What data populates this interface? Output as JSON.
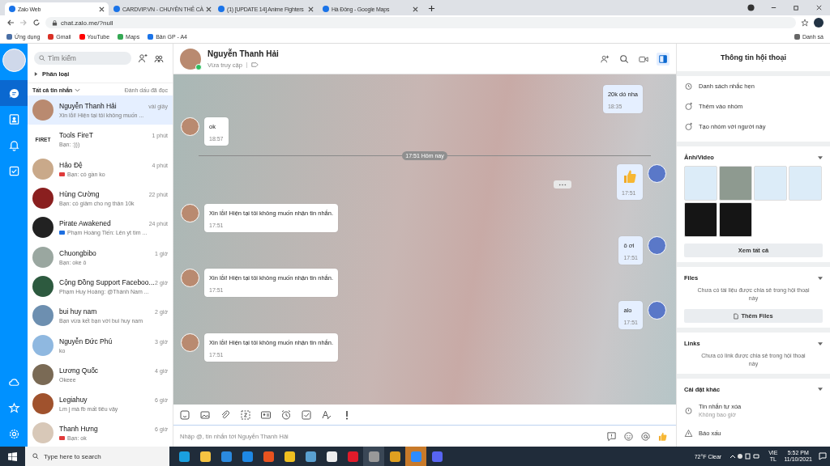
{
  "browser": {
    "tabs": [
      {
        "label": "Zalo Web",
        "selected": true
      },
      {
        "label": "CARDVIP.VN - CHUYÊN THẺ CÀ",
        "selected": false
      },
      {
        "label": "(1) [UPDATE 14] Anime Fighters",
        "selected": false
      },
      {
        "label": "Hà Đông - Google Maps",
        "selected": false
      }
    ],
    "address": "chat.zalo.me/?null",
    "bookmarks": [
      {
        "label": "Ứng dụng",
        "kind": "apps"
      },
      {
        "label": "Gmail",
        "kind": "gmail"
      },
      {
        "label": "YouTube",
        "kind": "youtube"
      },
      {
        "label": "Maps",
        "kind": "maps"
      },
      {
        "label": "Bản GP - A4",
        "kind": "site"
      }
    ],
    "reading_list": "Danh sá"
  },
  "conversation_list": {
    "search_placeholder": "Tìm kiếm",
    "category": "Phân loại",
    "filter": "Tất cả tin nhắn",
    "mark_read": "Đánh dấu đã đọc",
    "items": [
      {
        "name": "Nguyễn Thanh Hải",
        "time": "vài giây",
        "preview": "Xin lỗi! Hiện tại tôi không muốn ...",
        "selected": true
      },
      {
        "name": "Tools FireT",
        "time": "1 phút",
        "preview": "Bạn: :)))",
        "logo_text": "FIRET",
        "selected": false
      },
      {
        "name": "Hảo Đệ",
        "time": "4 phút",
        "preview": "Bạn: có gần ko",
        "color": "#e03b3b",
        "selected": false
      },
      {
        "name": "Hùng Cường",
        "time": "22 phút",
        "preview": "Bạn: có giảm cho ng thân 10k",
        "selected": false
      },
      {
        "name": "Pirate Awakened",
        "time": "24 phút",
        "preview": "Phạm Hoàng Tiến: Lên yt tìm ...",
        "color": "#1e6fe0",
        "selected": false
      },
      {
        "name": "Chuongbibo",
        "time": "1 giờ",
        "preview": "Bạn: oke ô",
        "selected": false
      },
      {
        "name": "Cộng Đồng Support Faceboo...",
        "time": "2 giờ",
        "preview": "Phạm Huy Hoàng: @Thành Nam ...",
        "selected": false
      },
      {
        "name": "bui huy nam",
        "time": "2 giờ",
        "preview": "Bạn vừa kết bạn với bui huy nam",
        "selected": false
      },
      {
        "name": "Nguyễn Đức Phú",
        "time": "3 giờ",
        "preview": "ko",
        "selected": false
      },
      {
        "name": "Lương Quốc",
        "time": "4 giờ",
        "preview": "Okeee",
        "selected": false
      },
      {
        "name": "Legiahuy",
        "time": "6 giờ",
        "preview": "Lm j mà fb mất tiêu vậy",
        "selected": false
      },
      {
        "name": "Thanh Hưng",
        "time": "6 giờ",
        "preview": "Bạn: ok",
        "color": "#e03b3b",
        "selected": false
      }
    ]
  },
  "chat": {
    "name": "Nguyễn Thanh Hải",
    "status": "Vừa truy cập",
    "messages": [
      {
        "kind": "outgoing",
        "text": "20k dó nha",
        "time": "18:35"
      },
      {
        "kind": "incoming",
        "text": "ok",
        "time": "18:57"
      },
      {
        "kind": "divider",
        "text": "17:51 Hôm nay"
      },
      {
        "kind": "like",
        "time": "17:51"
      },
      {
        "kind": "incoming",
        "text": "Xin lỗi! Hiện tại tôi không muốn nhận tin nhắn.",
        "time": "17:51"
      },
      {
        "kind": "outgoing",
        "text": "ô ơi",
        "time": "17:51"
      },
      {
        "kind": "incoming",
        "text": "Xin lỗi! Hiện tại tôi không muốn nhận tin nhắn.",
        "time": "17:51"
      },
      {
        "kind": "outgoing",
        "text": "alo",
        "time": "17:51"
      },
      {
        "kind": "incoming",
        "text": "Xin lỗi! Hiện tại tôi không muốn nhận tin nhắn.",
        "time": "17:51"
      }
    ],
    "input_placeholder": "Nhập @, tin nhắn tới Nguyễn Thanh Hải"
  },
  "info_panel": {
    "title": "Thông tin hội thoại",
    "actions": [
      "Danh sách nhắc hẹn",
      "Thêm vào nhóm",
      "Tạo nhóm với người này"
    ],
    "media": {
      "title": "Ảnh/Video",
      "thumbnails": [
        {
          "kind": "light"
        },
        {
          "kind": "chat"
        },
        {
          "kind": "light"
        },
        {
          "kind": "light"
        },
        {
          "kind": "dark"
        },
        {
          "kind": "dark"
        }
      ],
      "button": "Xem tất cả"
    },
    "files": {
      "title": "Files",
      "empty": "Chưa có tài liệu được chia sẻ trong hội thoại này",
      "button": "Thêm Files"
    },
    "links": {
      "title": "Links",
      "empty": "Chưa có link được chia sẻ trong hội thoại này"
    },
    "settings": {
      "title": "Cài đặt khác",
      "auto_delete": "Tin nhắn tự xóa",
      "auto_delete_value": "Không bao giờ",
      "report": "Báo xấu"
    }
  },
  "taskbar": {
    "search_placeholder": "Type here to search",
    "weather": "72°F  Clear",
    "language": "VIE",
    "layout": "TL",
    "time": "5:52 PM",
    "date": "11/10/2021"
  }
}
